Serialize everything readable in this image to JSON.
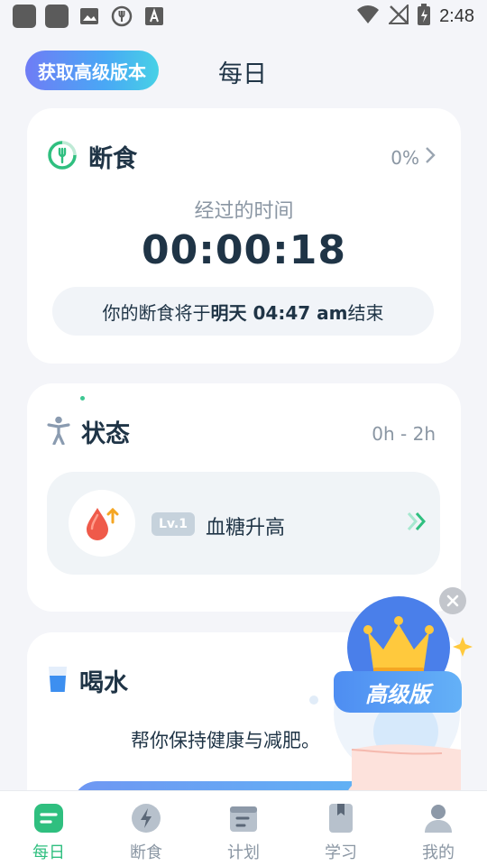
{
  "status_bar": {
    "time": "2:48"
  },
  "header": {
    "pro_button": "获取高级版本",
    "title": "每日"
  },
  "fasting": {
    "title": "断食",
    "percent": "0%",
    "elapsed_label": "经过的时间",
    "timer": "00:00:18",
    "end_prefix": "你的断食将于",
    "end_time": "明天 04:47 am",
    "end_suffix": "结束"
  },
  "state": {
    "title": "状态",
    "range": "0h - 2h",
    "level": "Lv.1",
    "label": "血糖升高"
  },
  "water": {
    "title": "喝水",
    "subtitle": "帮你保持健康与减肥。"
  },
  "promo": {
    "label": "高级版"
  },
  "tabs": [
    {
      "label": "每日",
      "active": true
    },
    {
      "label": "断食"
    },
    {
      "label": "计划"
    },
    {
      "label": "学习"
    },
    {
      "label": "我的"
    }
  ],
  "colors": {
    "accent_green": "#2fbf7f",
    "text_dark": "#1f3446",
    "text_muted": "#8a96a3",
    "promo_blue": "#4e8df2"
  }
}
